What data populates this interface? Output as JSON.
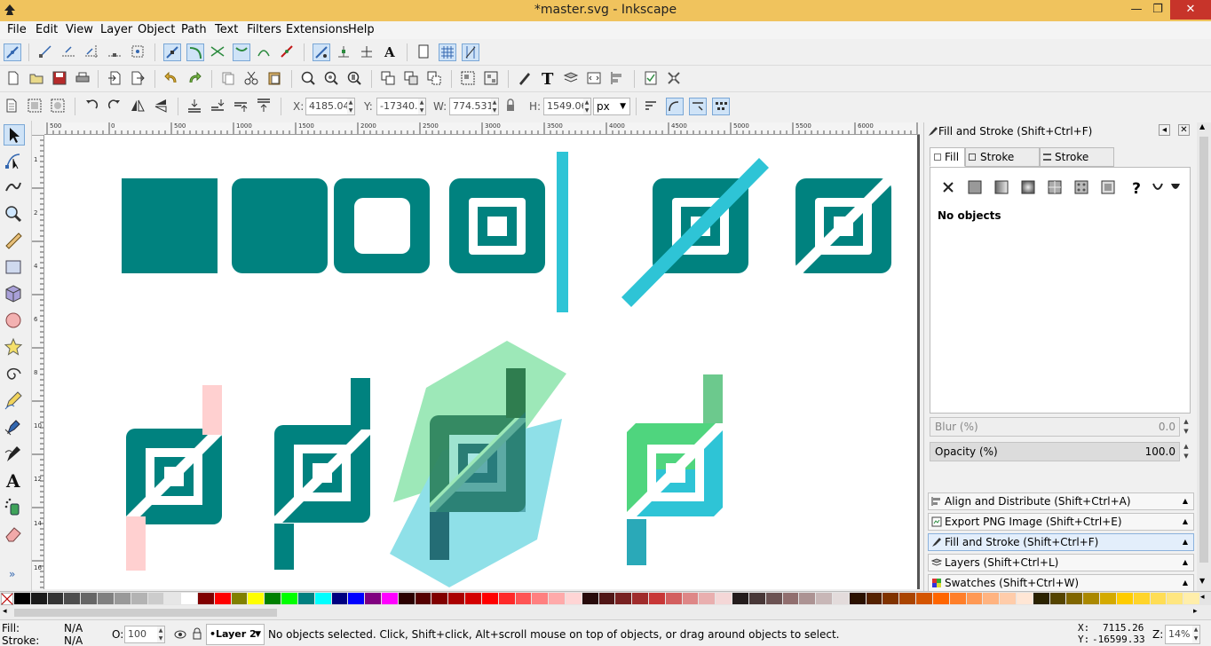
{
  "window": {
    "title": "*master.svg - Inkscape",
    "minimize": "—",
    "maximize": "❐",
    "close": "✕"
  },
  "menu": [
    "File",
    "Edit",
    "View",
    "Layer",
    "Object",
    "Path",
    "Text",
    "Filters",
    "Extensions",
    "Help"
  ],
  "selector_bar": {
    "x_label": "X:",
    "x_value": "4185.04",
    "y_label": "Y:",
    "y_value": "-17340.",
    "w_label": "W:",
    "w_value": "774.531",
    "h_label": "H:",
    "h_value": "1549.06",
    "unit": "px"
  },
  "ruler": {
    "h_labels": [
      "500",
      "0",
      "500",
      "1000",
      "1500",
      "2000",
      "2500",
      "3000",
      "3500",
      "4000",
      "4500",
      "5000",
      "5500",
      "6000"
    ],
    "v_labels": [
      "1",
      "2",
      "4",
      "6",
      "8",
      "10",
      "12",
      "14",
      "16"
    ]
  },
  "dock": {
    "title": "Fill and Stroke (Shift+Ctrl+F)",
    "tabs": [
      "Fill",
      "Stroke paint",
      "Stroke style"
    ],
    "fill_unset_glyph": "?",
    "no_objects": "No objects",
    "blur_label": "Blur (%)",
    "blur_value": "0.0",
    "opacity_label": "Opacity (%)",
    "opacity_value": "100.0",
    "panels": [
      "Align and Distribute (Shift+Ctrl+A)",
      "Export PNG Image (Shift+Ctrl+E)",
      "Fill and Stroke (Shift+Ctrl+F)",
      "Layers (Shift+Ctrl+L)",
      "Swatches (Shift+Ctrl+W)"
    ]
  },
  "colors": {
    "teal": "#00827f",
    "cyan": "#2ec4d6",
    "pink": "#ffd0d0",
    "mint": "#9de8b8",
    "light_cyan": "#8fe0e8",
    "green": "#4fd57e",
    "dark_green": "#2f7d4f"
  },
  "status": {
    "fill_label": "Fill:",
    "fill_value": "N/A",
    "stroke_label": "Stroke:",
    "stroke_value": "N/A",
    "opacity_label": "O:",
    "opacity_value": "100",
    "layer": "•Layer 2",
    "message": "No objects selected. Click, Shift+click, Alt+scroll mouse on top of objects, or drag around objects to select.",
    "x_label": "X:",
    "x_value": "7115.26",
    "y_label": "Y:",
    "y_value": "-16599.33",
    "zoom_label": "Z:",
    "zoom_value": "14%"
  }
}
